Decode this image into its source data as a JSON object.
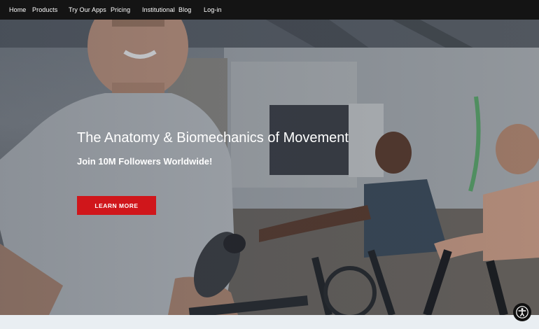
{
  "nav": {
    "items": [
      {
        "label": "Home"
      },
      {
        "label": "Products"
      },
      {
        "label": "Try Our Apps"
      },
      {
        "label": "Pricing"
      },
      {
        "label": "Institutional"
      },
      {
        "label": "Blog"
      },
      {
        "label": "Log-in"
      }
    ]
  },
  "hero": {
    "headline": "The Anatomy & Biomechanics of Movement",
    "subheadline": "Join 10M Followers Worldwide!",
    "cta_label": "LEARN MORE"
  },
  "colors": {
    "nav_background": "#141414",
    "cta_background": "#d0161b",
    "text": "#ffffff"
  },
  "icons": {
    "accessibility": "accessibility-icon"
  }
}
